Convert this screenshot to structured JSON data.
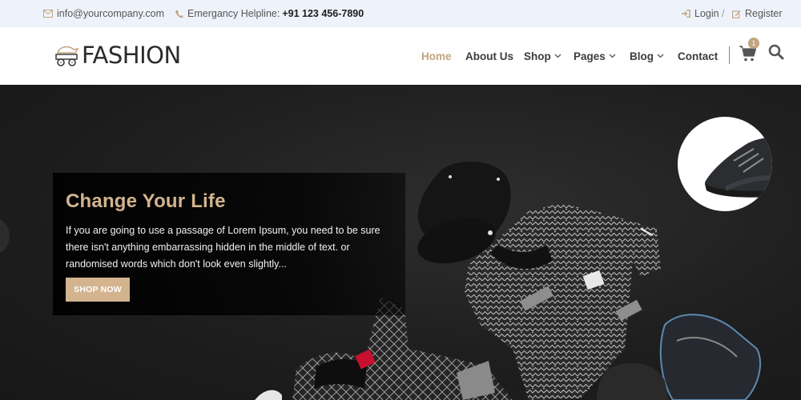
{
  "topbar": {
    "email": "info@yourcompany.com",
    "helpline_label": "Emergancy Helpline:",
    "helpline_number": "+91 123 456-7890",
    "login": "Login",
    "separator": "/",
    "register": "Register"
  },
  "header": {
    "logo_text": "FASHION",
    "cart_count": "1",
    "nav": [
      {
        "label": "Home",
        "active": true
      },
      {
        "label": "About Us"
      },
      {
        "label": "Shop"
      },
      {
        "label": "Pages"
      },
      {
        "label": "Blog"
      },
      {
        "label": "Contact"
      }
    ]
  },
  "hero": {
    "title": "Change Your Life",
    "text": "If you are going to use a passage of Lorem Ipsum, you need to be sure there isn't anything embarrassing hidden in the middle of text. or randomised words which don't look even slightly...",
    "button": "SHOP NOW"
  },
  "colors": {
    "accent": "#c2a47e",
    "button": "#d3b48f",
    "topbar_bg": "#eef3fb",
    "hero_bg": "#1e1e1e"
  },
  "icons": [
    "envelope-icon",
    "phone-icon",
    "sign-in-icon",
    "edit-icon",
    "cart-icon",
    "search-icon",
    "chevron-down-icon"
  ]
}
